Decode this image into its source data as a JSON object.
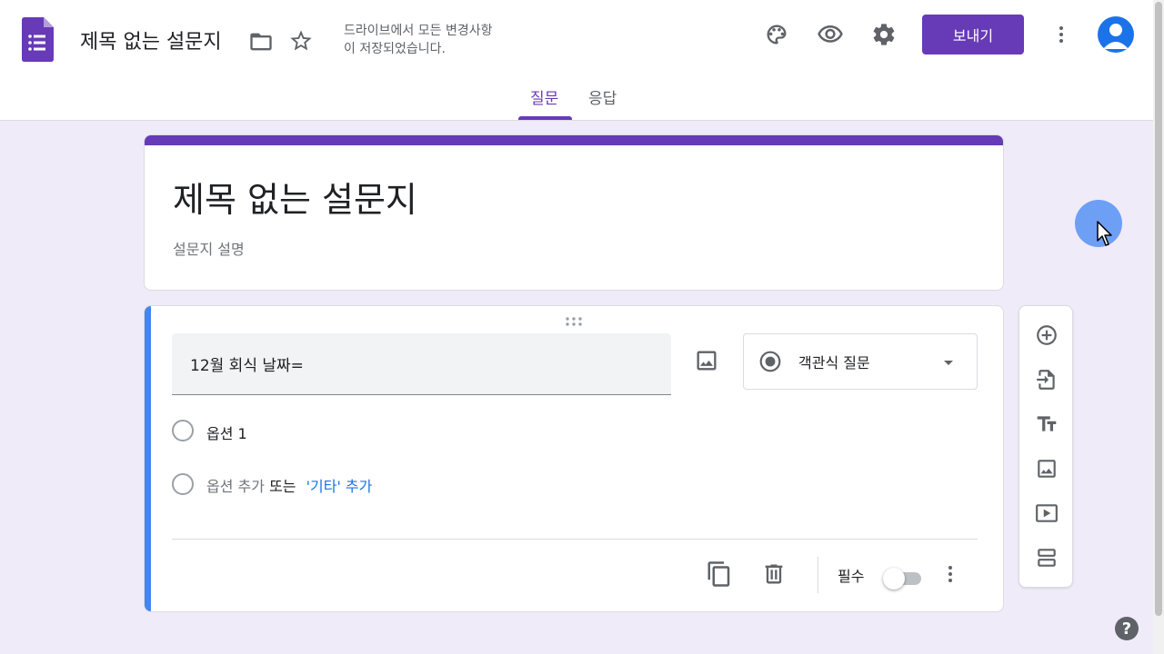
{
  "header": {
    "doc_title": "제목 없는 설문지",
    "save_status_line1": "드라이브에서 모든 변경사항",
    "save_status_line2": "이 저장되었습니다.",
    "send_label": "보내기"
  },
  "tabs": [
    {
      "label": "질문",
      "active": true
    },
    {
      "label": "응답",
      "active": false
    }
  ],
  "form": {
    "title": "제목 없는 설문지",
    "description_placeholder": "설문지 설명"
  },
  "question": {
    "text": "12월 회식 날짜=",
    "type_label": "객관식 질문",
    "options": [
      "옵션 1"
    ],
    "add_option_label": "옵션 추가",
    "or_label": "또는",
    "add_other_label": "'기타' 추가",
    "required_label": "필수",
    "required": false
  },
  "help": {
    "label": "?"
  },
  "colors": {
    "accent": "#673ab7",
    "question_active": "#4285f4",
    "link": "#1a73e8",
    "background": "#efebf8"
  }
}
